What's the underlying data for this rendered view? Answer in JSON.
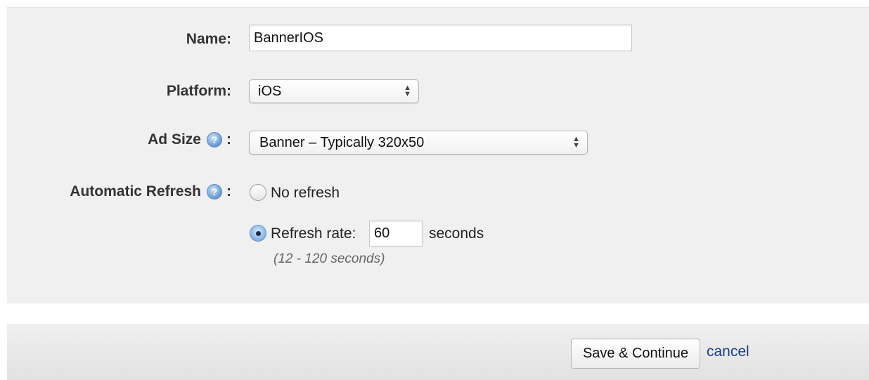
{
  "form": {
    "name": {
      "label": "Name:",
      "value": "BannerIOS"
    },
    "platform": {
      "label": "Platform:",
      "selected": "iOS"
    },
    "ad_size": {
      "label": "Ad Size",
      "colon": ":",
      "help_icon": "question-help-icon",
      "selected": "Banner – Typically 320x50"
    },
    "automatic_refresh": {
      "label": "Automatic Refresh",
      "colon": ":",
      "help_icon": "question-help-icon",
      "options": [
        {
          "label": "No refresh",
          "checked": false
        },
        {
          "label": "Refresh rate:",
          "checked": true
        }
      ],
      "refresh_rate_value": "60",
      "unit": "seconds",
      "hint": "(12 - 120 seconds)"
    }
  },
  "footer": {
    "save_label": "Save & Continue",
    "cancel_label": "cancel"
  },
  "colors": {
    "panel_background": "#f0f0f0",
    "link": "#1a3f8a",
    "radio_checked": "#5b8fcf"
  }
}
